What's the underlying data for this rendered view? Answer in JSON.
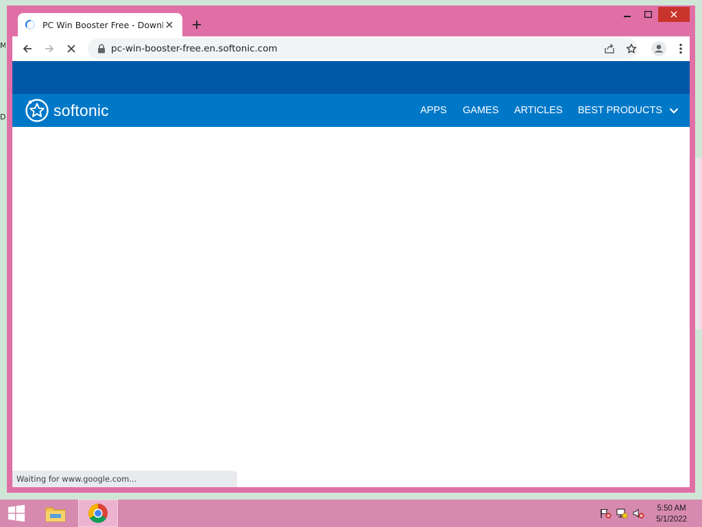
{
  "desktop": {
    "left_glyph_1": "M",
    "left_glyph_2": "D"
  },
  "browser": {
    "tab": {
      "title": "PC Win Booster Free - Download",
      "loading": true
    },
    "toolbar": {
      "url": "pc-win-booster-free.en.softonic.com"
    },
    "status_text": "Waiting for www.google.com..."
  },
  "page": {
    "logo_text": "softonic",
    "nav": [
      {
        "label": "APPS"
      },
      {
        "label": "GAMES"
      },
      {
        "label": "ARTICLES"
      },
      {
        "label": "BEST PRODUCTS"
      }
    ],
    "colors": {
      "top_band": "#0059a8",
      "nav_band": "#0078c8"
    }
  },
  "taskbar": {
    "clock_time": "5:50 AM",
    "clock_date": "5/1/2022"
  },
  "colors": {
    "window_frame": "#e06fa6",
    "taskbar": "#d78ab0",
    "close_button": "#c8342b"
  }
}
